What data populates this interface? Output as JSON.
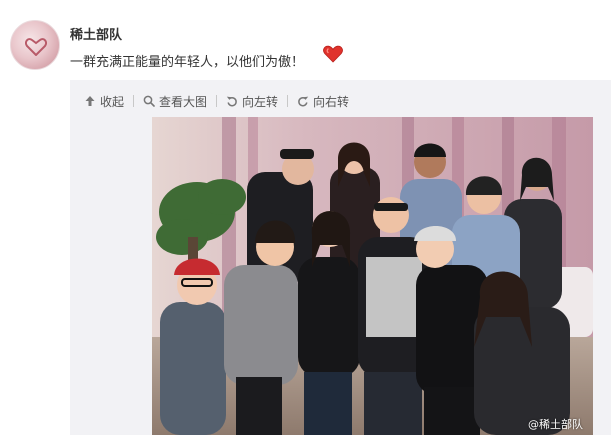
{
  "user": {
    "name": "稀土部队",
    "avatar_icon": "heart-hands-avatar"
  },
  "post": {
    "text": "一群充满正能量的年轻人，以他们为傲！",
    "emoji": "red-heart"
  },
  "toolbar": {
    "collapse_label": "收起",
    "view_large_label": "查看大图",
    "rotate_left_label": "向左转",
    "rotate_right_label": "向右转"
  },
  "image": {
    "watermark": "@稀土部队"
  },
  "colors": {
    "text": "#333333",
    "repost_bg": "#f2f2f5",
    "heart": "#e0322c"
  }
}
